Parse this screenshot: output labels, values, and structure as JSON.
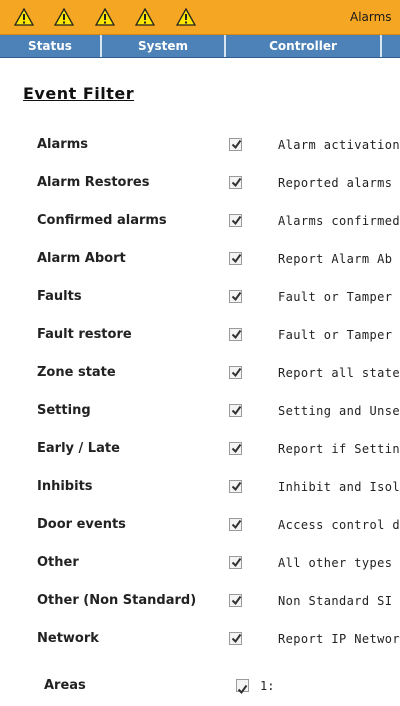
{
  "header": {
    "title": "Alarms",
    "warning_icons": [
      "warning-icon",
      "warning-icon",
      "warning-icon",
      "warning-icon",
      "warning-icon"
    ]
  },
  "nav": {
    "tabs": [
      "Status",
      "System",
      "Controller",
      ""
    ]
  },
  "page": {
    "title": "Event Filter"
  },
  "events": [
    {
      "label": "Alarms",
      "checked": true,
      "description": "Alarm activation"
    },
    {
      "label": "Alarm Restores",
      "checked": true,
      "description": "Reported alarms"
    },
    {
      "label": "Confirmed alarms",
      "checked": true,
      "description": "Alarms confirmed"
    },
    {
      "label": "Alarm Abort",
      "checked": true,
      "description": "Report Alarm Ab"
    },
    {
      "label": "Faults",
      "checked": true,
      "description": "Fault or Tamper"
    },
    {
      "label": "Fault restore",
      "checked": true,
      "description": "Fault or Tamper"
    },
    {
      "label": "Zone state",
      "checked": true,
      "description": "Report all state"
    },
    {
      "label": "Setting",
      "checked": true,
      "description": "Setting and Unse"
    },
    {
      "label": "Early / Late",
      "checked": true,
      "description": "Report if Setting"
    },
    {
      "label": "Inhibits",
      "checked": true,
      "description": "Inhibit and Isola"
    },
    {
      "label": "Door events",
      "checked": true,
      "description": "Access control do"
    },
    {
      "label": "Other",
      "checked": true,
      "description": "All other types o"
    },
    {
      "label": "Other (Non Standard)",
      "checked": true,
      "description": "Non Standard SI"
    },
    {
      "label": "Network",
      "checked": true,
      "description": "Report IP Networ"
    }
  ],
  "areas": {
    "label": "Areas",
    "checked": true,
    "value": "1:"
  },
  "colors": {
    "alarm_bar": "#f5a623",
    "nav_bar": "#4c82b8",
    "warning_fill": "#ffe600"
  }
}
